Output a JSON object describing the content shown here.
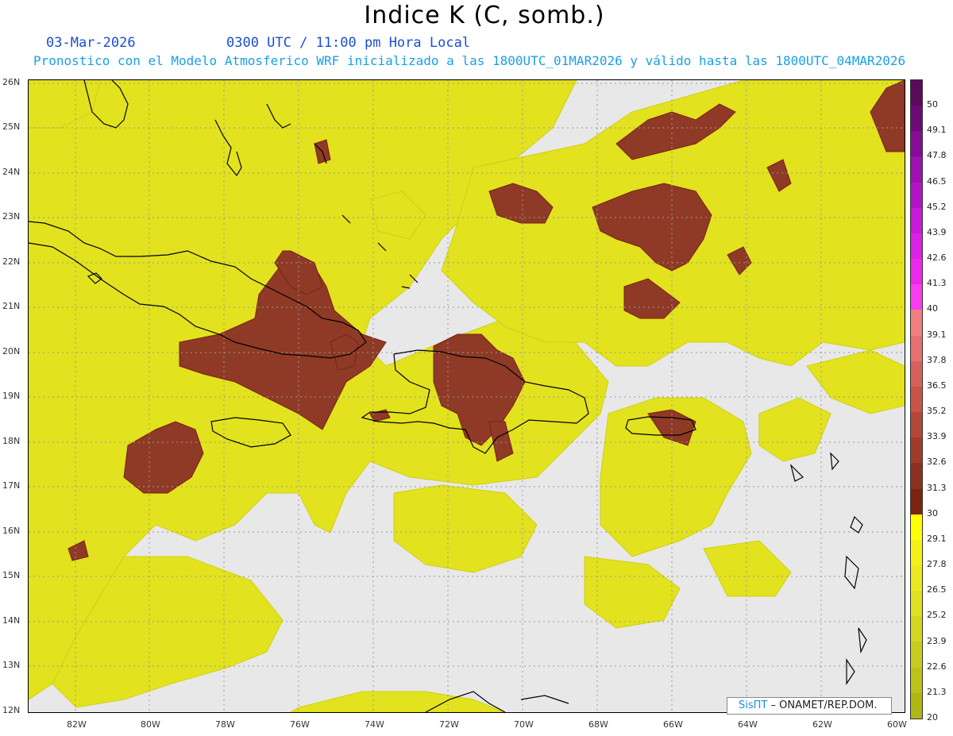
{
  "header": {
    "title": "Indice K (C, somb.)",
    "date": "03-Mar-2026",
    "time": "0300 UTC / 11:00 pm Hora Local",
    "forecast": "Pronostico con el Modelo Atmosferico WRF inicializado a las 1800UTC_01MAR2026 y válido hasta las  1800UTC_04MAR2026"
  },
  "map": {
    "lat_labels": [
      "26N",
      "25N",
      "24N",
      "23N",
      "22N",
      "21N",
      "20N",
      "19N",
      "18N",
      "17N",
      "16N",
      "15N",
      "14N",
      "13N",
      "12N"
    ],
    "lon_labels": [
      "82W",
      "80W",
      "78W",
      "76W",
      "74W",
      "72W",
      "70W",
      "68W",
      "66W",
      "64W",
      "62W",
      "60W"
    ],
    "land_outline_color": "#000000",
    "ocean_color": "#e8e8e8",
    "features": [
      "Florida",
      "Bahamas",
      "Cuba",
      "Jamaica",
      "Hispaniola",
      "Puerto Rico",
      "Lesser Antilles"
    ]
  },
  "colorbar": {
    "labels": [
      "50",
      "49.1",
      "47.8",
      "46.5",
      "45.2",
      "43.9",
      "42.6",
      "41.3",
      "40",
      "39.1",
      "37.8",
      "36.5",
      "35.2",
      "33.9",
      "32.6",
      "31.3",
      "30",
      "29.1",
      "27.8",
      "26.5",
      "25.2",
      "23.9",
      "22.6",
      "21.3",
      "20"
    ],
    "colors": [
      "#5a0a5a",
      "#6e0a78",
      "#860c96",
      "#9e10b0",
      "#b414c8",
      "#c81ad8",
      "#dc20e4",
      "#ec28ec",
      "#fa3cf0",
      "#f08080",
      "#e47070",
      "#d8605c",
      "#c85448",
      "#b44838",
      "#a03c2c",
      "#8c3020",
      "#7a2410",
      "#ffff00",
      "#f6f216",
      "#ecea1e",
      "#e0e020",
      "#d4d620",
      "#c8cc1c",
      "#bcc218",
      "#b0b614"
    ]
  },
  "credit": {
    "brand": "SisПТ",
    "org": "– ONAMET/REP.DOM."
  }
}
